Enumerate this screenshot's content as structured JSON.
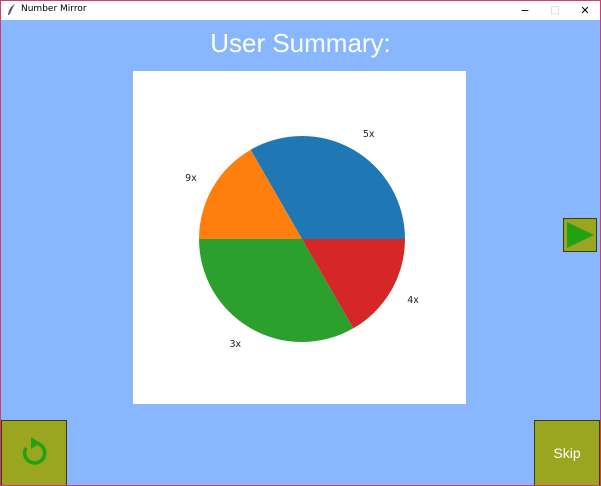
{
  "window": {
    "title": "Number Mirror",
    "controls": {
      "minimize": "−",
      "maximize": "□",
      "close": "✕"
    }
  },
  "heading": "User Summary:",
  "chart_data": {
    "type": "pie",
    "title": "",
    "labels": [
      "5x",
      "9x",
      "3x",
      "4x"
    ],
    "values": [
      33.3,
      16.7,
      33.3,
      16.7
    ],
    "colors": [
      "#1f77b4",
      "#ff7f0e",
      "#2ca02c",
      "#d62728"
    ],
    "start_angle_deg": 0,
    "direction": "counterclockwise"
  },
  "buttons": {
    "next_icon": "play-triangle-icon",
    "reset_icon": "refresh-arrow-icon",
    "skip_label": "Skip"
  },
  "colors": {
    "background": "#88b7ff",
    "button": "#9aa520",
    "icon_green": "#22a114"
  }
}
